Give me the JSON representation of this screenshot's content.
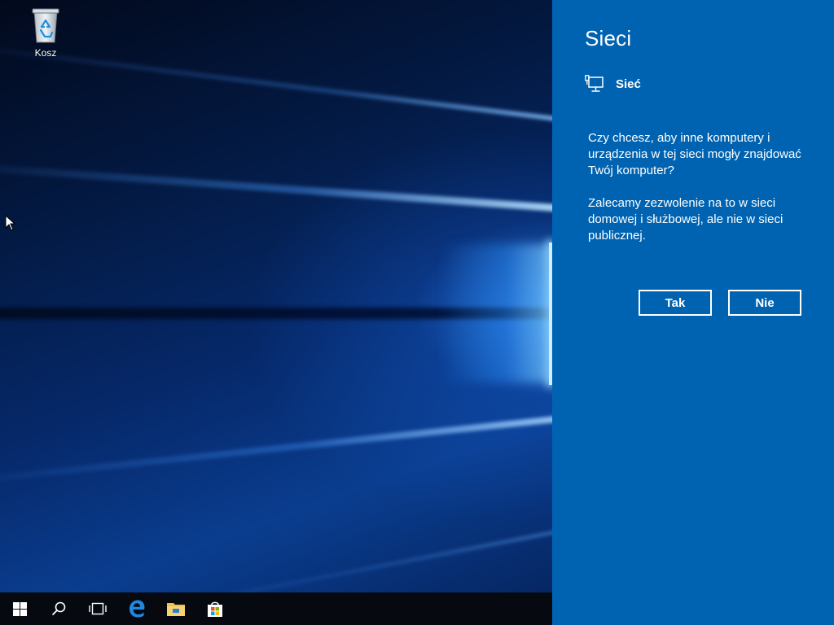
{
  "desktop": {
    "icons": [
      {
        "label": "Kosz",
        "icon": "recycle-bin-icon"
      }
    ]
  },
  "taskbar": {
    "items": [
      {
        "name": "start",
        "icon": "windows-logo-icon"
      },
      {
        "name": "search",
        "icon": "search-icon"
      },
      {
        "name": "task-view",
        "icon": "task-view-icon"
      },
      {
        "name": "edge",
        "icon": "edge-browser-icon"
      },
      {
        "name": "file-explorer",
        "icon": "folder-icon"
      },
      {
        "name": "store",
        "icon": "store-bag-icon"
      }
    ]
  },
  "panel": {
    "title": "Sieci",
    "network_name": "Sieć",
    "network_icon": "ethernet-monitor-icon",
    "question": "Czy chcesz, aby inne komputery i urządzenia w tej sieci mogły znajdować Twój komputer?",
    "recommendation": "Zalecamy zezwolenie na to w sieci domowej i służbowej, ale nie w sieci publicznej.",
    "buttons": {
      "yes": "Tak",
      "no": "Nie"
    },
    "accent_color": "#0063b1"
  }
}
